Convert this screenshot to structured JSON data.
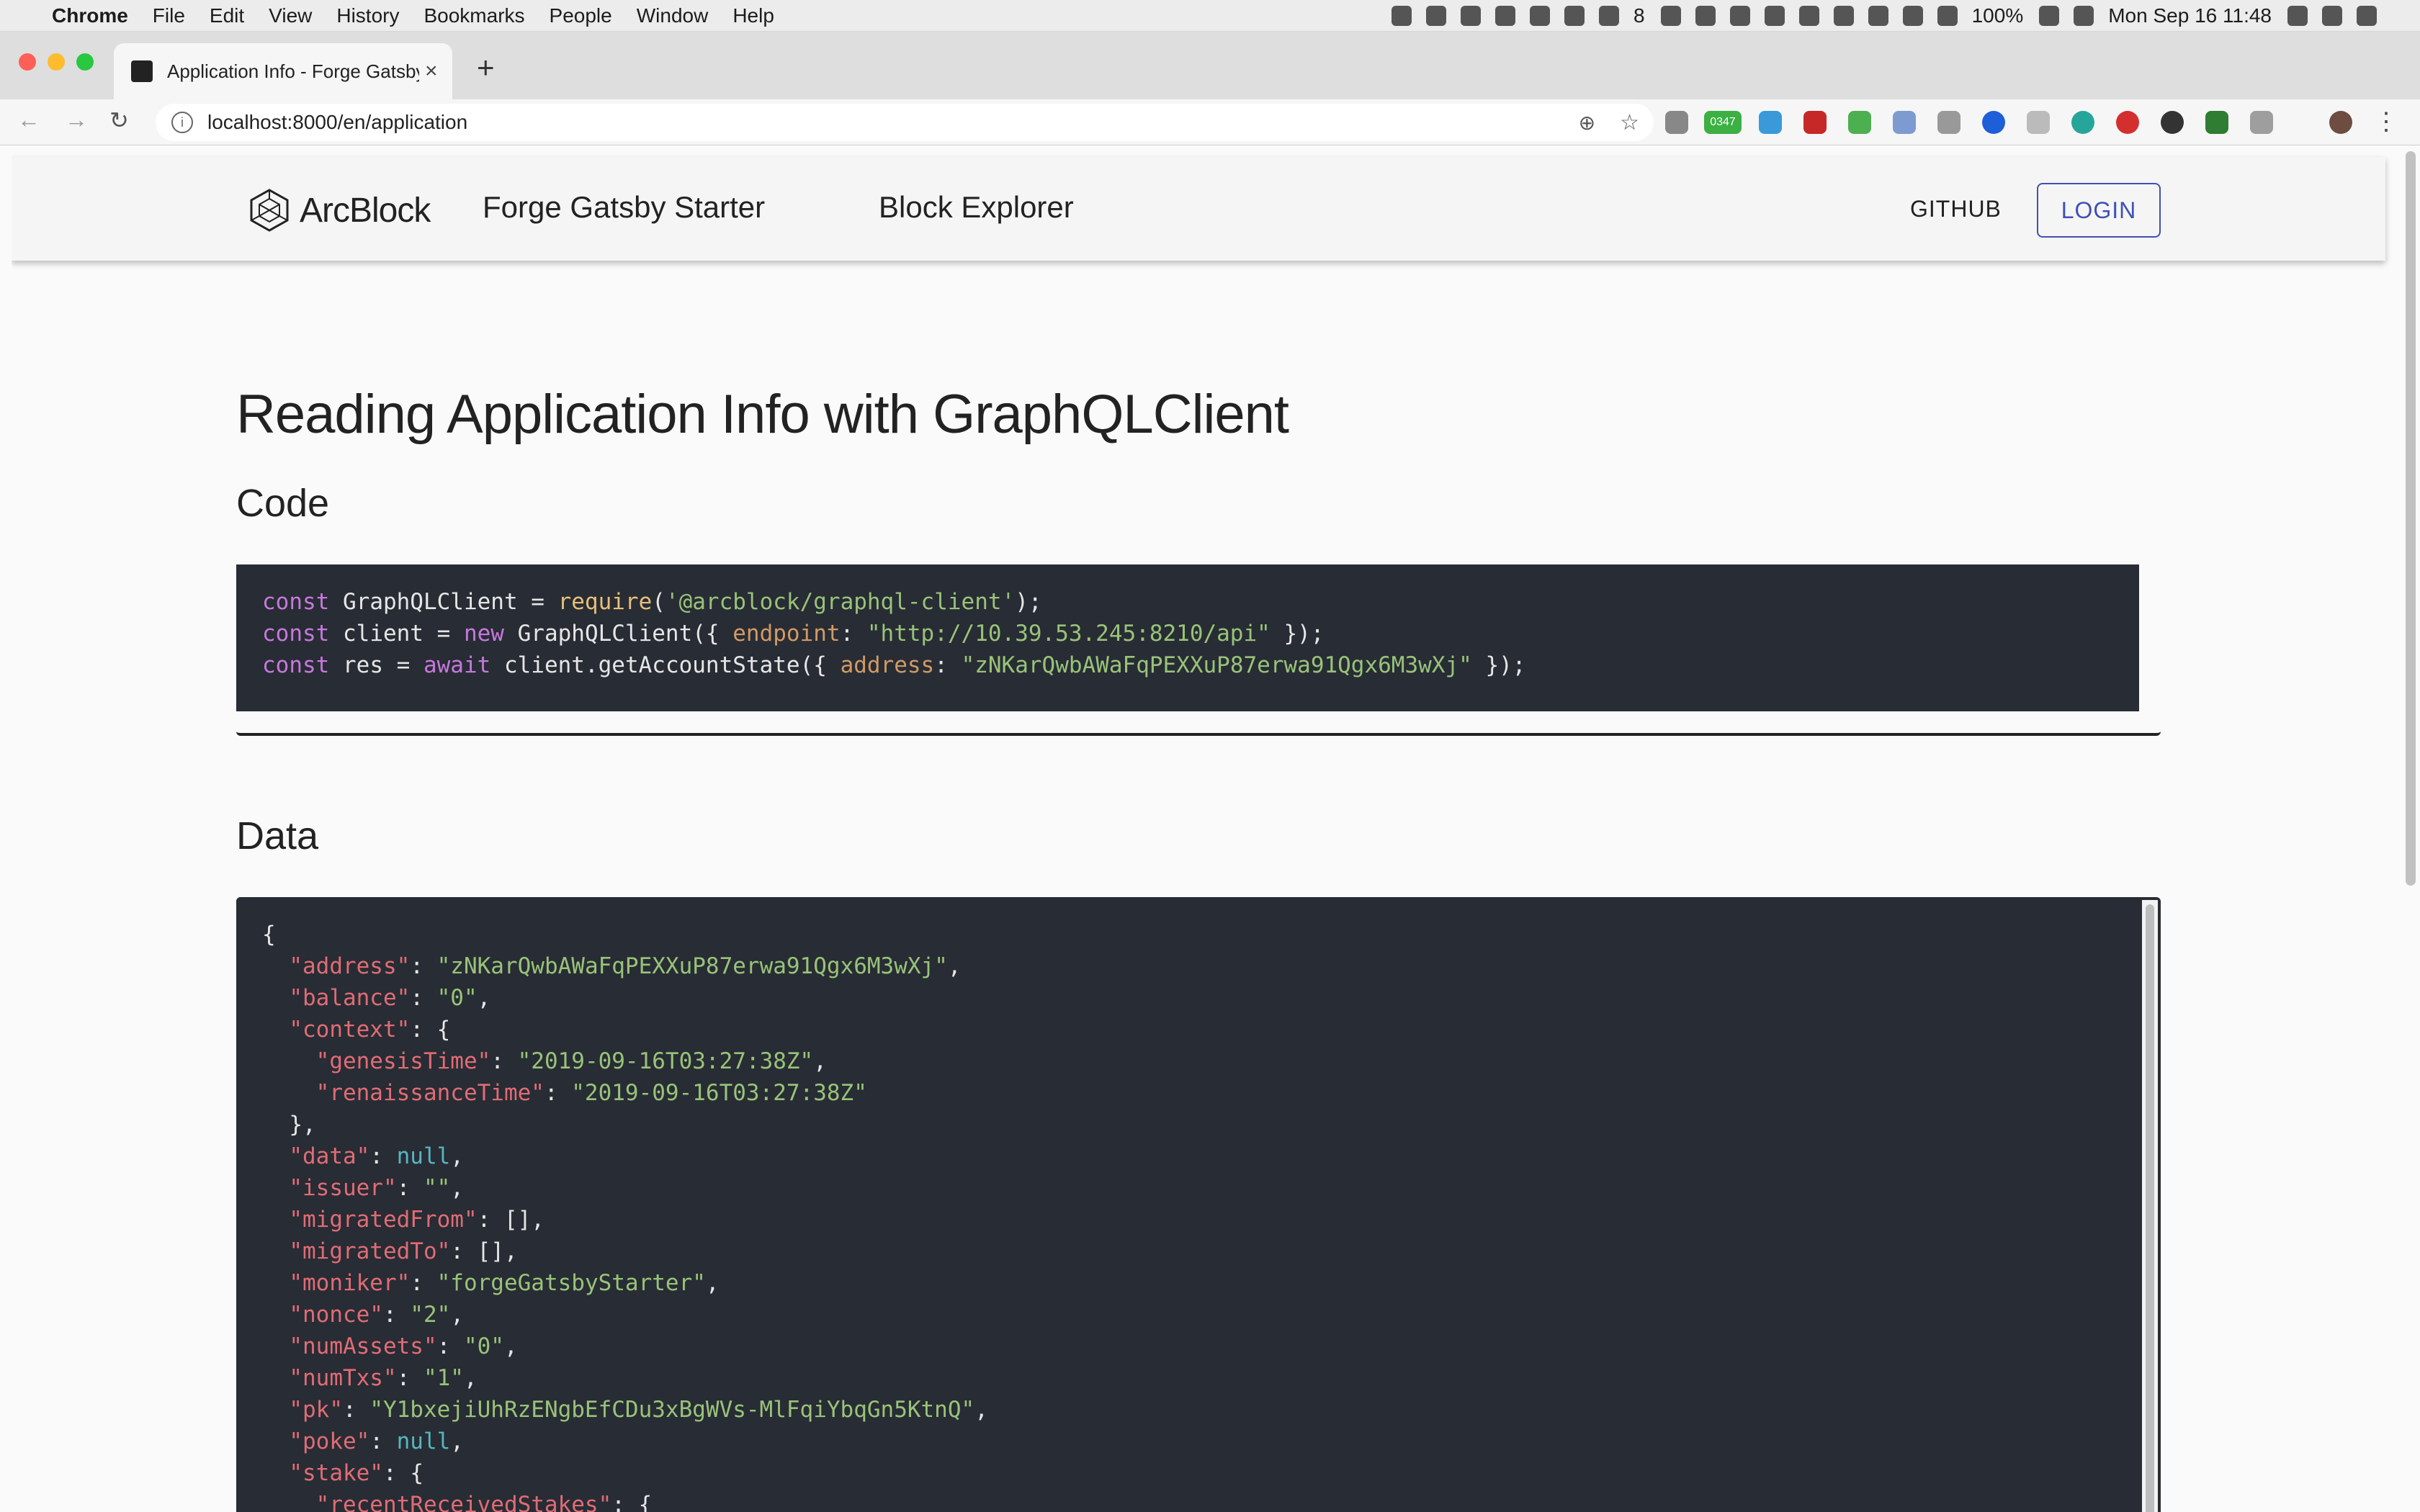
{
  "menubar": {
    "app": "Chrome",
    "items": [
      "File",
      "Edit",
      "View",
      "History",
      "Bookmarks",
      "People",
      "Window",
      "Help"
    ],
    "battery": "100%",
    "notif_count": "8",
    "datetime": "Mon Sep 16  11:48"
  },
  "tab": {
    "title": "Application Info - Forge Gatsby",
    "close": "×",
    "new_tab": "+"
  },
  "toolbar": {
    "url": "localhost:8000/en/application",
    "ext_badge": "0347"
  },
  "header": {
    "brand": "ArcBlock",
    "site_name": "Forge Gatsby Starter",
    "explorer": "Block Explorer",
    "github": "GITHUB",
    "login": "LOGIN"
  },
  "main": {
    "title": "Reading Application Info with GraphQLClient",
    "code_heading": "Code",
    "data_heading": "Data"
  },
  "code": {
    "line1": {
      "kw": "const",
      "mid1": " GraphQLClient = ",
      "fn": "require",
      "p1": "(",
      "str": "'@arcblock/graphql-client'",
      "end": ");"
    },
    "line2": {
      "kw": "const",
      "mid1": " client = ",
      "kw2": "new",
      "mid2": " GraphQLClient({ ",
      "prop": "endpoint",
      "colon": ": ",
      "str": "\"http://10.39.53.245:8210/api\"",
      "end": " });"
    },
    "line3": {
      "kw": "const",
      "mid1": " res = ",
      "kw2": "await",
      "mid2": " client.getAccountState({ ",
      "prop": "address",
      "colon": ": ",
      "str": "\"zNKarQwbAWaFqPEXXuP87erwa91Qgx6M3wXj\"",
      "end": " });"
    }
  },
  "json_lines": [
    {
      "indent": "",
      "key": "",
      "sep": "",
      "val": "",
      "type": "",
      "tail": "{"
    },
    {
      "indent": "  ",
      "key": "\"address\"",
      "sep": ": ",
      "val": "\"zNKarQwbAWaFqPEXXuP87erwa91Qgx6M3wXj\"",
      "type": "str",
      "tail": ","
    },
    {
      "indent": "  ",
      "key": "\"balance\"",
      "sep": ": ",
      "val": "\"0\"",
      "type": "str",
      "tail": ","
    },
    {
      "indent": "  ",
      "key": "\"context\"",
      "sep": ": ",
      "val": "",
      "type": "",
      "tail": "{"
    },
    {
      "indent": "    ",
      "key": "\"genesisTime\"",
      "sep": ": ",
      "val": "\"2019-09-16T03:27:38Z\"",
      "type": "str",
      "tail": ","
    },
    {
      "indent": "    ",
      "key": "\"renaissanceTime\"",
      "sep": ": ",
      "val": "\"2019-09-16T03:27:38Z\"",
      "type": "str",
      "tail": ""
    },
    {
      "indent": "  ",
      "key": "",
      "sep": "",
      "val": "",
      "type": "",
      "tail": "},"
    },
    {
      "indent": "  ",
      "key": "\"data\"",
      "sep": ": ",
      "val": "null",
      "type": "nul",
      "tail": ","
    },
    {
      "indent": "  ",
      "key": "\"issuer\"",
      "sep": ": ",
      "val": "\"\"",
      "type": "str",
      "tail": ","
    },
    {
      "indent": "  ",
      "key": "\"migratedFrom\"",
      "sep": ": ",
      "val": "",
      "type": "",
      "tail": "[],"
    },
    {
      "indent": "  ",
      "key": "\"migratedTo\"",
      "sep": ": ",
      "val": "",
      "type": "",
      "tail": "[],"
    },
    {
      "indent": "  ",
      "key": "\"moniker\"",
      "sep": ": ",
      "val": "\"forgeGatsbyStarter\"",
      "type": "str",
      "tail": ","
    },
    {
      "indent": "  ",
      "key": "\"nonce\"",
      "sep": ": ",
      "val": "\"2\"",
      "type": "str",
      "tail": ","
    },
    {
      "indent": "  ",
      "key": "\"numAssets\"",
      "sep": ": ",
      "val": "\"0\"",
      "type": "str",
      "tail": ","
    },
    {
      "indent": "  ",
      "key": "\"numTxs\"",
      "sep": ": ",
      "val": "\"1\"",
      "type": "str",
      "tail": ","
    },
    {
      "indent": "  ",
      "key": "\"pk\"",
      "sep": ": ",
      "val": "\"Y1bxejiUhRzENgbEfCDu3xBgWVs-MlFqiYbqGn5KtnQ\"",
      "type": "str",
      "tail": ","
    },
    {
      "indent": "  ",
      "key": "\"poke\"",
      "sep": ": ",
      "val": "null",
      "type": "nul",
      "tail": ","
    },
    {
      "indent": "  ",
      "key": "\"stake\"",
      "sep": ": ",
      "val": "",
      "type": "",
      "tail": "{"
    },
    {
      "indent": "    ",
      "key": "\"recentReceivedStakes\"",
      "sep": ": ",
      "val": "",
      "type": "",
      "tail": "{"
    }
  ],
  "colors": {
    "code_bg": "#282c34",
    "keyword": "#c678dd",
    "string": "#98c379",
    "json_key": "#e06c75",
    "login_accent": "#3f51b5"
  }
}
